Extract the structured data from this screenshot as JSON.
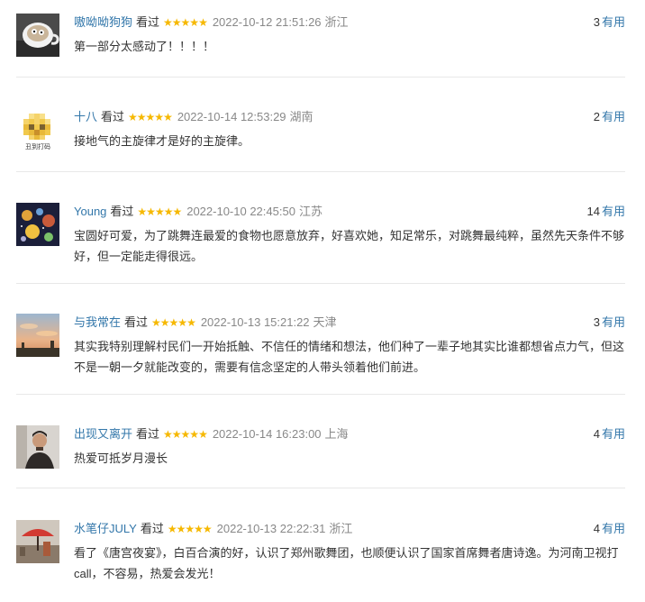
{
  "status_label": "看过",
  "useful_label": "有用",
  "star_glyphs": "★★★★★",
  "colors": {
    "username": "#3377aa",
    "star": "#f6b800",
    "meta_gray": "#888888"
  },
  "reviews": [
    {
      "user": "嗷呦呦狗狗",
      "time": "2022-10-12 21:51:26",
      "location": "浙江",
      "useful": "3",
      "content": "第一部分太感动了！！！！",
      "rating": 5,
      "avatar": "coffee-cup-photo"
    },
    {
      "user": "十八",
      "time": "2022-10-14 12:53:29",
      "location": "湖南",
      "useful": "2",
      "content": "接地气的主旋律才是好的主旋律。",
      "rating": 5,
      "avatar": "pixelated-emoji-avatar",
      "avatar_caption": "丑到打码"
    },
    {
      "user": "Young",
      "time": "2022-10-10 22:45:50",
      "location": "江苏",
      "useful": "14",
      "content": "宝圆好可爱，为了跳舞连最爱的食物也愿意放弃，好喜欢她，知足常乐，对跳舞最纯粹，虽然先天条件不够好，但一定能走得很远。",
      "rating": 5,
      "avatar": "planets-avatar"
    },
    {
      "user": "与我常在",
      "time": "2022-10-13 15:21:22",
      "location": "天津",
      "useful": "3",
      "content": "其实我特别理解村民们一开始抵触、不信任的情绪和想法，他们种了一辈子地其实比谁都想省点力气，但这不是一朝一夕就能改变的，需要有信念坚定的人带头领着他们前进。",
      "rating": 5,
      "avatar": "sunset-sky-photo"
    },
    {
      "user": "出现又离开",
      "time": "2022-10-14 16:23:00",
      "location": "上海",
      "useful": "4",
      "content": "热爱可抵岁月漫长",
      "rating": 5,
      "avatar": "person-photo"
    },
    {
      "user": "水笔仔JULY",
      "time": "2022-10-13 22:22:31",
      "location": "浙江",
      "useful": "4",
      "content": "看了《唐宫夜宴》，白百合演的好，认识了郑州歌舞团，也顺便认识了国家首席舞者唐诗逸。为河南卫视打call，不容易，热爱会发光！",
      "rating": 5,
      "avatar": "umbrella-street-photo"
    }
  ]
}
